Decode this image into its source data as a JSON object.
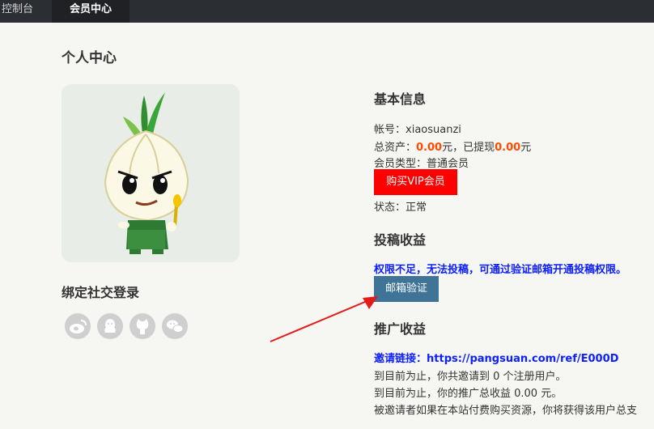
{
  "nav": {
    "tabs": [
      "控制台",
      "会员中心"
    ]
  },
  "page": {
    "title": "个人中心"
  },
  "social": {
    "title": "绑定社交登录",
    "icons": [
      "weibo-icon",
      "qq-icon",
      "github-icon",
      "wechat-icon"
    ]
  },
  "basic": {
    "title": "基本信息",
    "account_label": "帐号：",
    "account": "xiaosuanzi",
    "assets_label": "总资产：",
    "assets_value": "0.00",
    "yuan1": "元，已提现",
    "withdrawn_value": "0.00",
    "yuan2": "元",
    "member_type_label": "会员类型：",
    "member_type": "普通会员",
    "buy_vip": "购买VIP会员",
    "status_label": "状态：",
    "status": "正常"
  },
  "contribution": {
    "title": "投稿收益",
    "warning": "权限不足，无法投稿，可通过验证邮箱开通投稿权限。",
    "verify_button": "邮箱验证"
  },
  "promo": {
    "title": "推广收益",
    "invite_label": "邀请链接：",
    "invite_url": "https://pangsuan.com/ref/E000D",
    "line1": "到目前为止，你共邀请到 0 个注册用户。",
    "line2": "到目前为止，你的推广总收益 0.00 元。",
    "line3": "被邀请者如果在本站付费购买资源，你将获得该用户总支"
  },
  "colors": {
    "accent_red": "#ff0000",
    "link_blue": "#0c1fff",
    "button_blue": "#3f7496",
    "topbar": "#2b2e33"
  }
}
